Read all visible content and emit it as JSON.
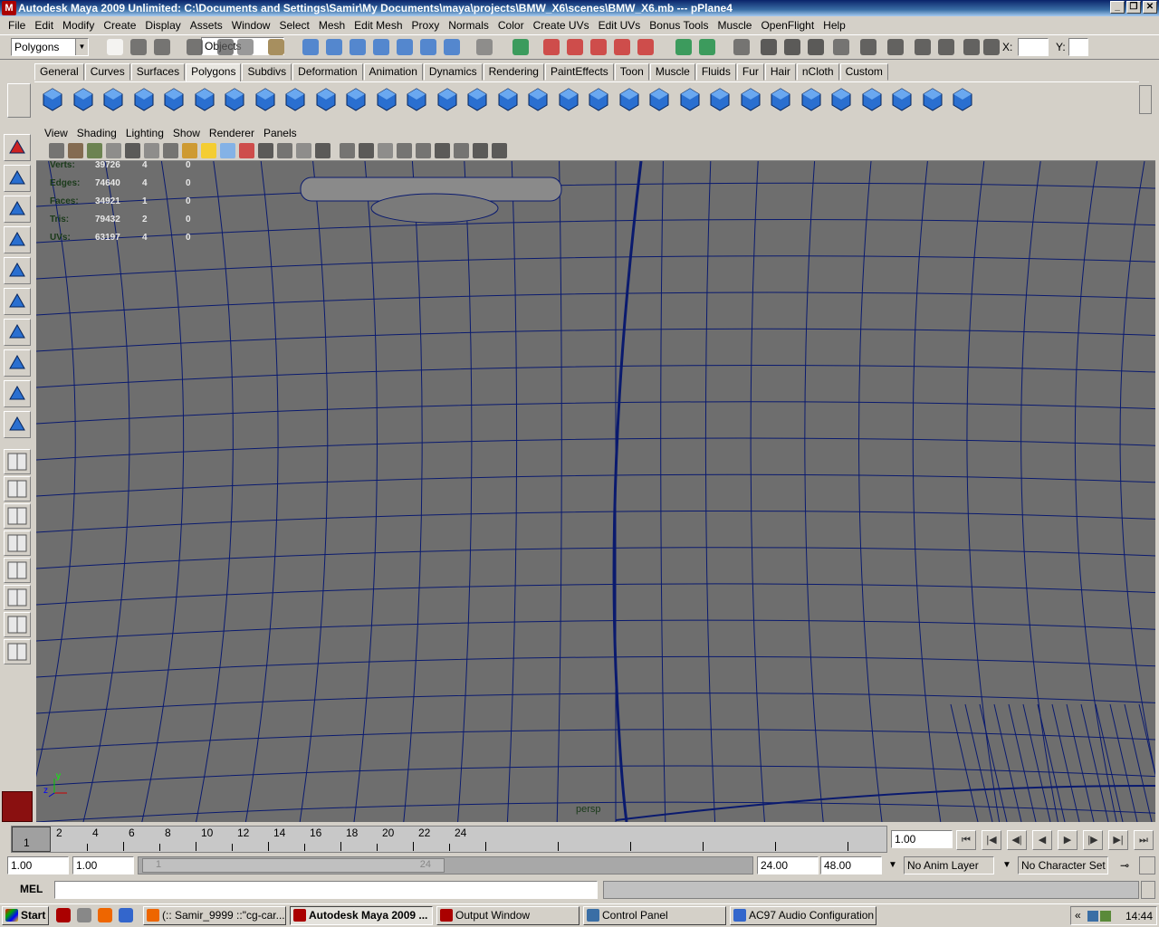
{
  "window": {
    "title": "Autodesk Maya 2009 Unlimited: C:\\Documents and Settings\\Samir\\My Documents\\maya\\projects\\BMW_X6\\scenes\\BMW_X6.mb  ---  pPlane4",
    "app_icon": "M"
  },
  "menubar": [
    "File",
    "Edit",
    "Modify",
    "Create",
    "Display",
    "Assets",
    "Window",
    "Select",
    "Mesh",
    "Edit Mesh",
    "Proxy",
    "Normals",
    "Color",
    "Create UVs",
    "Edit UVs",
    "Bonus Tools",
    "Muscle",
    "OpenFlight",
    "Help"
  ],
  "statusline": {
    "menuset": "Polygons",
    "selection_mode": "Objects",
    "x_label": "X:",
    "y_label": "Y:",
    "x_value": "",
    "y_value": ""
  },
  "shelf_tabs": [
    "General",
    "Curves",
    "Surfaces",
    "Polygons",
    "Subdivs",
    "Deformation",
    "Animation",
    "Dynamics",
    "Rendering",
    "PaintEffects",
    "Toon",
    "Muscle",
    "Fluids",
    "Fur",
    "Hair",
    "nCloth",
    "Custom"
  ],
  "shelf_active": "Polygons",
  "panel_menu": [
    "View",
    "Shading",
    "Lighting",
    "Show",
    "Renderer",
    "Panels"
  ],
  "hud": [
    {
      "label": "Verts:",
      "total": "39726",
      "selected": "4",
      "other": "0"
    },
    {
      "label": "Edges:",
      "total": "74640",
      "selected": "4",
      "other": "0"
    },
    {
      "label": "Faces:",
      "total": "34921",
      "selected": "1",
      "other": "0"
    },
    {
      "label": "Tris:",
      "total": "79432",
      "selected": "2",
      "other": "0"
    },
    {
      "label": "UVs:",
      "total": "63197",
      "selected": "4",
      "other": "0"
    }
  ],
  "viewport": {
    "camera": "persp",
    "axis_x": "x",
    "axis_y": "y",
    "axis_z": "z"
  },
  "timeline": {
    "current_frame": "1",
    "tick_labels": [
      "2",
      "4",
      "6",
      "8",
      "10",
      "12",
      "14",
      "16",
      "18",
      "20",
      "22",
      "24"
    ],
    "current_time_field": "1.00"
  },
  "range": {
    "start_time": "1.00",
    "playback_start": "1.00",
    "slider_start": "1",
    "slider_end": "24",
    "playback_end": "24.00",
    "end_time": "48.00",
    "anim_layer": "No Anim Layer",
    "character_set": "No Character Set"
  },
  "cmdline": {
    "label": "MEL",
    "value": ""
  },
  "taskbar": {
    "start": "Start",
    "items": [
      {
        "label": "(:: Samir_9999 ::\"cg-car...",
        "active": false
      },
      {
        "label": "Autodesk Maya 2009 ...",
        "active": true
      },
      {
        "label": "Output Window",
        "active": false
      },
      {
        "label": "Control Panel",
        "active": false
      },
      {
        "label": "AC97 Audio Configuration",
        "active": false
      }
    ],
    "clock": "14:44",
    "tray_chevron": "«"
  },
  "colors": {
    "viewport_bg": "#6e6e6e",
    "wire": "#0a1a6e",
    "titlebar": "#0a246a",
    "ui_bg": "#d4d0c8",
    "shelf_icon": "#2a6fd0"
  },
  "icons": {
    "minimize": "minimize-icon",
    "maximize": "restore-icon",
    "close": "close-icon"
  }
}
